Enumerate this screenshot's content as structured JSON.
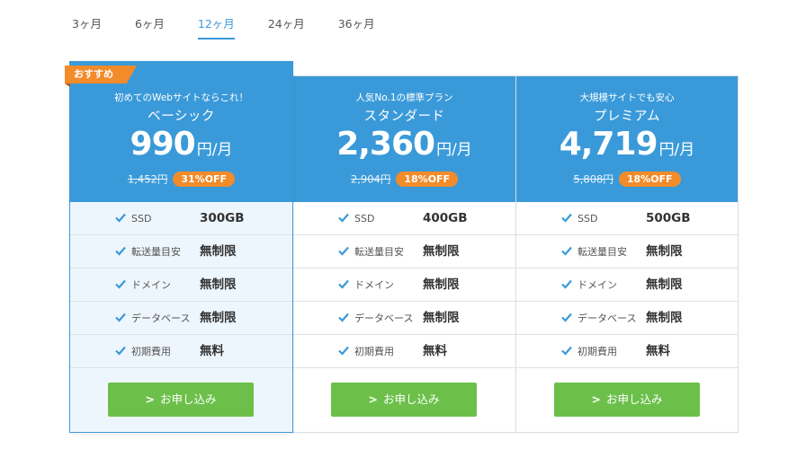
{
  "tabs": [
    "3ヶ月",
    "6ヶ月",
    "12ヶ月",
    "24ヶ月",
    "36ヶ月"
  ],
  "active_tab": "12ヶ月",
  "ribbon": "おすすめ",
  "plans": [
    {
      "tagline": "初めてのWebサイトならこれ！",
      "name": "ベーシック",
      "price": "990",
      "unit": "円/月",
      "original": "1,452円",
      "discount": "31%OFF",
      "features": [
        {
          "label": "SSD",
          "value": "300GB"
        },
        {
          "label": "転送量目安",
          "value": "無制限"
        },
        {
          "label": "ドメイン",
          "value": "無制限"
        },
        {
          "label": "データベース",
          "value": "無制限"
        },
        {
          "label": "初期費用",
          "value": "無料"
        }
      ],
      "button": "お申し込み"
    },
    {
      "tagline": "人気No.1の標準プラン",
      "name": "スタンダード",
      "price": "2,360",
      "unit": "円/月",
      "original": "2,904円",
      "discount": "18%OFF",
      "features": [
        {
          "label": "SSD",
          "value": "400GB"
        },
        {
          "label": "転送量目安",
          "value": "無制限"
        },
        {
          "label": "ドメイン",
          "value": "無制限"
        },
        {
          "label": "データベース",
          "value": "無制限"
        },
        {
          "label": "初期費用",
          "value": "無料"
        }
      ],
      "button": "お申し込み"
    },
    {
      "tagline": "大規模サイトでも安心",
      "name": "プレミアム",
      "price": "4,719",
      "unit": "円/月",
      "original": "5,808円",
      "discount": "18%OFF",
      "features": [
        {
          "label": "SSD",
          "value": "500GB"
        },
        {
          "label": "転送量目安",
          "value": "無制限"
        },
        {
          "label": "ドメイン",
          "value": "無制限"
        },
        {
          "label": "データベース",
          "value": "無制限"
        },
        {
          "label": "初期費用",
          "value": "無料"
        }
      ],
      "button": "お申し込み"
    }
  ],
  "colors": {
    "primary": "#3a9ad9",
    "accent": "#f28b2a",
    "button": "#6cc04a",
    "featured_bg": "#eef6fd"
  },
  "icons": {
    "check": "check-icon",
    "arrow": "chevron-right-icon"
  }
}
